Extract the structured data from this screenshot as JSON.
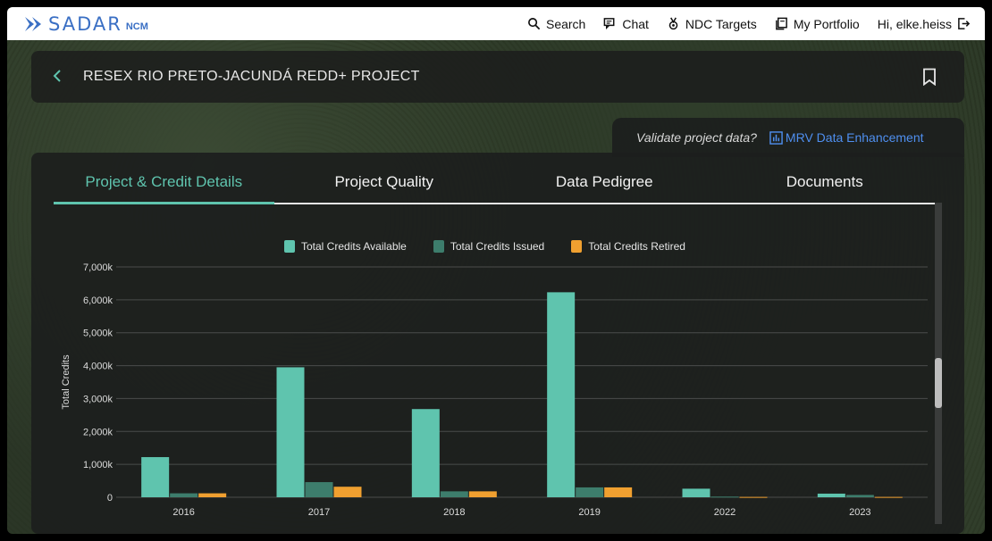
{
  "brand": {
    "name": "SADAR",
    "sub": "NCM",
    "color": "#3a6fc4"
  },
  "nav": [
    {
      "label": "Search",
      "icon": "search-icon"
    },
    {
      "label": "Chat",
      "icon": "chat-icon"
    },
    {
      "label": "NDC Targets",
      "icon": "medal-icon"
    },
    {
      "label": "My Portfolio",
      "icon": "portfolio-icon"
    },
    {
      "label": "Hi, elke.heiss",
      "icon": "logout-icon"
    }
  ],
  "project": {
    "title": "RESEX RIO PRETO-JACUNDÁ REDD+ PROJECT"
  },
  "validate": {
    "question": "Validate project data?",
    "link": "MRV Data Enhancement"
  },
  "tabs": [
    {
      "label": "Project & Credit Details",
      "active": true
    },
    {
      "label": "Project Quality",
      "active": false
    },
    {
      "label": "Data Pedigree",
      "active": false
    },
    {
      "label": "Documents",
      "active": false
    }
  ],
  "colors": {
    "accent": "#5fc4ae",
    "issued": "#3d7d6c",
    "retired": "#f0a030",
    "link": "#4f8ff0"
  },
  "chart_data": {
    "type": "bar",
    "categories": [
      "2016",
      "2017",
      "2018",
      "2019",
      "2022",
      "2023"
    ],
    "series": [
      {
        "name": "Total Credits Available",
        "color": "#5fc4ae",
        "values": [
          1220,
          3950,
          2680,
          6230,
          260,
          110
        ]
      },
      {
        "name": "Total Credits Issued",
        "color": "#3d7d6c",
        "values": [
          120,
          460,
          180,
          300,
          20,
          70
        ]
      },
      {
        "name": "Total Credits Retired",
        "color": "#f0a030",
        "values": [
          120,
          320,
          180,
          300,
          10,
          10
        ]
      }
    ],
    "ylabel": "Total Credits",
    "ylim": [
      0,
      7000
    ],
    "yticks": [
      0,
      1000,
      2000,
      3000,
      4000,
      5000,
      6000,
      7000
    ],
    "ytick_labels": [
      "0",
      "1,000k",
      "2,000k",
      "3,000k",
      "4,000k",
      "5,000k",
      "6,000k",
      "7,000k"
    ],
    "legend": "top",
    "grid": true
  }
}
